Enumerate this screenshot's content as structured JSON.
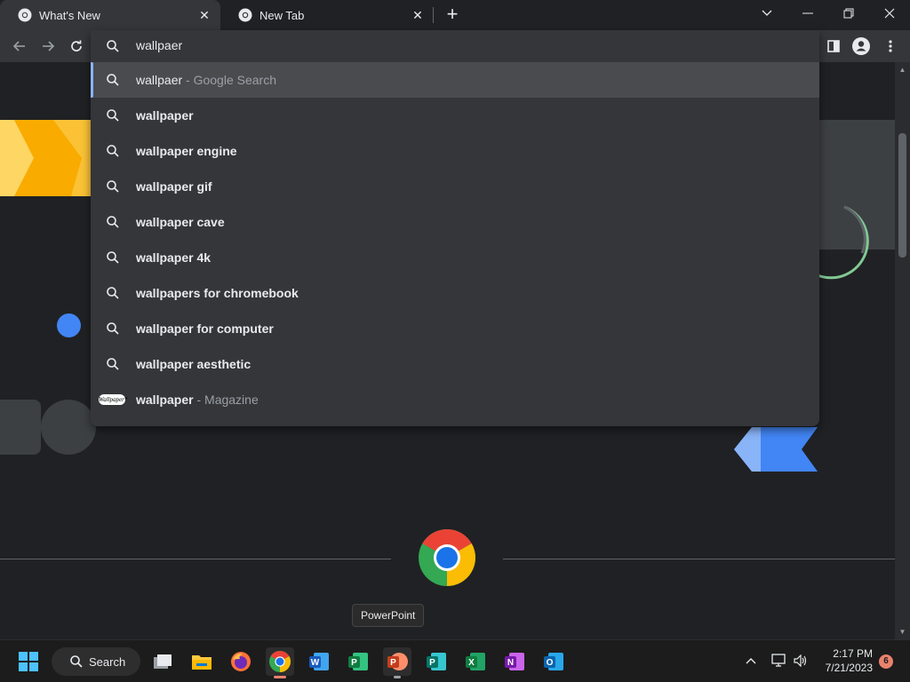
{
  "tabs": [
    {
      "title": "What's New",
      "active": true
    },
    {
      "title": "New Tab",
      "active": false
    }
  ],
  "omnibox": {
    "input_value": "wallpaer",
    "suggestions": [
      {
        "bold": "",
        "plain": "wallpaer",
        "dim": " - Google Search",
        "icon": "search-icon",
        "selected": true
      },
      {
        "bold": "wallpaper",
        "plain": "",
        "dim": "",
        "icon": "search-icon"
      },
      {
        "bold": "wallpaper engine",
        "plain": "",
        "dim": "",
        "icon": "search-icon"
      },
      {
        "bold": "wallpaper gif",
        "plain": "",
        "dim": "",
        "icon": "search-icon"
      },
      {
        "bold": "wallpaper cave",
        "plain": "",
        "dim": "",
        "icon": "search-icon"
      },
      {
        "bold": "wallpaper 4k",
        "plain": "",
        "dim": "",
        "icon": "search-icon"
      },
      {
        "bold": "wallpapers for chromebook",
        "plain": "",
        "dim": "",
        "icon": "search-icon"
      },
      {
        "bold": "wallpaper for computer",
        "plain": "",
        "dim": "",
        "icon": "search-icon"
      },
      {
        "bold": "wallpaper aesthetic",
        "plain": "",
        "dim": "",
        "icon": "search-icon"
      },
      {
        "bold": "wallpaper",
        "plain": "",
        "dim": " - Magazine",
        "icon": "wallpaper-magazine-logo",
        "badge": "Wallpaper*"
      }
    ]
  },
  "tooltip": "PowerPoint",
  "taskbar": {
    "search_label": "Search",
    "time": "2:17 PM",
    "date": "7/21/2023",
    "notification_count": "6",
    "apps": [
      "windows-start",
      "task-view",
      "file-explorer",
      "firefox",
      "chrome",
      "word",
      "project",
      "powerpoint",
      "publisher",
      "excel",
      "onenote",
      "outlook"
    ]
  },
  "colors": {
    "accent": "#8ab4f8",
    "background": "#202124",
    "toolbar": "#35363a",
    "selected_row": "#4a4b4f"
  }
}
